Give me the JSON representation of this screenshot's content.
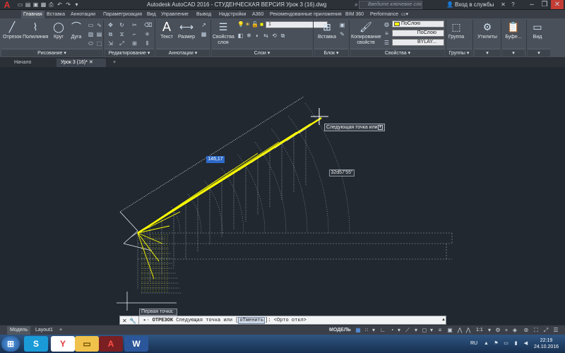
{
  "titlebar": {
    "logo": "A",
    "title": "Autodesk AutoCAD 2016 - СТУДЕНЧЕСКАЯ ВЕРСИЯ    Урок 3 (16).dwg",
    "search_placeholder": "Введите ключевое слово/фразу",
    "signin": "Вход в службы",
    "quick_access_icons": [
      "new-icon",
      "open-icon",
      "save-icon",
      "saveas-icon",
      "print-icon",
      "undo-icon",
      "redo-icon"
    ]
  },
  "ribbon_tabs": [
    "Главная",
    "Вставка",
    "Аннотации",
    "Параметризация",
    "Вид",
    "Управление",
    "Вывод",
    "Надстройки",
    "A360",
    "Рекомендованные приложения",
    "BIM 360",
    "Performance"
  ],
  "ribbon": {
    "draw": {
      "buttons": [
        "Отрезок",
        "Полилиния",
        "Круг",
        "Дуга"
      ],
      "label": "Рисование"
    },
    "modify": {
      "label": "Редактирование"
    },
    "annotation": {
      "buttons": [
        "Текст",
        "Размер"
      ],
      "label": "Аннотации"
    },
    "layers": {
      "button": "Свойства слоя",
      "layer_value": "1",
      "label": "Слои"
    },
    "block": {
      "button": "Вставка",
      "label": "Блок"
    },
    "properties": {
      "button": "Копирование свойств",
      "color_value": "ПоСлою",
      "linetype_value": "ПоСлою",
      "lineweight_value": "BYLAY...",
      "label": "Свойства"
    },
    "groups": {
      "button": "Группа",
      "label": "Группы"
    },
    "utilities": {
      "button": "Утилиты"
    },
    "clipboard": {
      "button": "Буфе..."
    },
    "view": {
      "button": "Вид"
    }
  },
  "doc_tabs": [
    "Начало",
    "Урок 3 (16)*"
  ],
  "canvas": {
    "dim_input": "146,17",
    "tooltip": "Следующая точка или",
    "angle": "32d57'55\"",
    "first_point": "Первая точка:"
  },
  "command": {
    "keyword": "ОТРЕЗОК",
    "prompt": "Следующая точка или [",
    "option": "оТменить",
    "tail": "]:  <Орто откл>"
  },
  "status": {
    "model_tab": "Модель",
    "layout_tab": "Layout1",
    "mode": "МОДЕЛЬ",
    "scale": "1:1"
  },
  "taskbar": {
    "lang": "RU",
    "time": "22:19",
    "date": "24.10.2016"
  },
  "colors": {
    "canvas": "#212830",
    "ribbon": "#4a5059",
    "accent_line": "#ffff00",
    "dim_input_bg": "#2c69c8"
  }
}
